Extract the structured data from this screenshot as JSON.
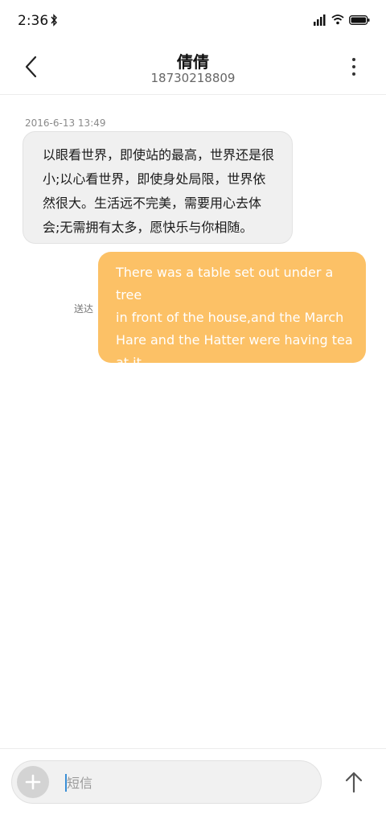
{
  "status_bar": {
    "time": "2:36",
    "icons": [
      "bluetooth-icon",
      "signal-icon",
      "wifi-icon",
      "battery-icon"
    ]
  },
  "header": {
    "contact_name": "倩倩",
    "contact_number": "18730218809",
    "icons": [
      "back-chevron-icon",
      "more-vertical-icon"
    ]
  },
  "conversation": {
    "timestamp": "2016-6-13 13:49",
    "incoming": {
      "lines": [
        "以眼看世界，即使站的最高，世界还是很",
        "小;以心看世界，即使身处局限，世界依",
        "然很大。生活远不完美，需要用心去体",
        "会;无需拥有太多，愿快乐与你相随。"
      ]
    },
    "outgoing": {
      "lines": [
        "There was a table set out under a tree",
        "in front of the house,and the March",
        "Hare and the Hatter were having tea",
        "at it."
      ],
      "status": "送达"
    }
  },
  "composer": {
    "placeholder": "短信",
    "value": "",
    "icons": [
      "plus-icon",
      "send-arrow-icon"
    ]
  },
  "colors": {
    "outgoing_bubble": "#fcc166",
    "incoming_bubble": "#f0f0f0",
    "caret": "#3a8fd6"
  }
}
